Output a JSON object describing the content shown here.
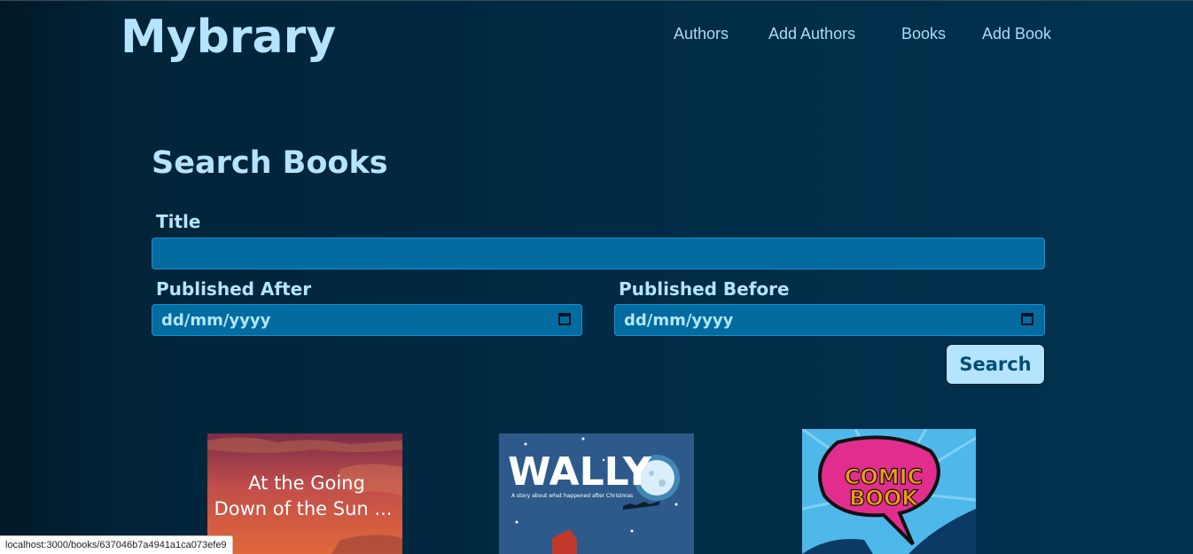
{
  "app": {
    "logo": "Mybrary"
  },
  "nav": {
    "items": [
      {
        "label": "Authors"
      },
      {
        "label": "Add Authors"
      },
      {
        "label": "Books"
      },
      {
        "label": "Add Book"
      }
    ]
  },
  "search": {
    "heading": "Search Books",
    "title_label": "Title",
    "title_value": "",
    "published_after_label": "Published After",
    "published_after_placeholder": "dd/mm/yyyy",
    "published_before_label": "Published Before",
    "published_before_placeholder": "dd/mm/yyyy",
    "submit_label": "Search"
  },
  "books": [
    {
      "cover_text_line1": "At the Going",
      "cover_text_line2": "Down of the Sun ..."
    },
    {
      "cover_title": "WALLY",
      "cover_subtitle": "A story about what happened after Christmas"
    },
    {
      "cover_text_line1": "COMIC",
      "cover_text_line2": "BOOK"
    }
  ],
  "status_bar": {
    "url": "localhost:3000/books/637046b7a4941a1ca073efe9"
  },
  "colors": {
    "accent_light": "#b4e4ff",
    "input_bg": "#026ba0",
    "background": "#012a44"
  }
}
